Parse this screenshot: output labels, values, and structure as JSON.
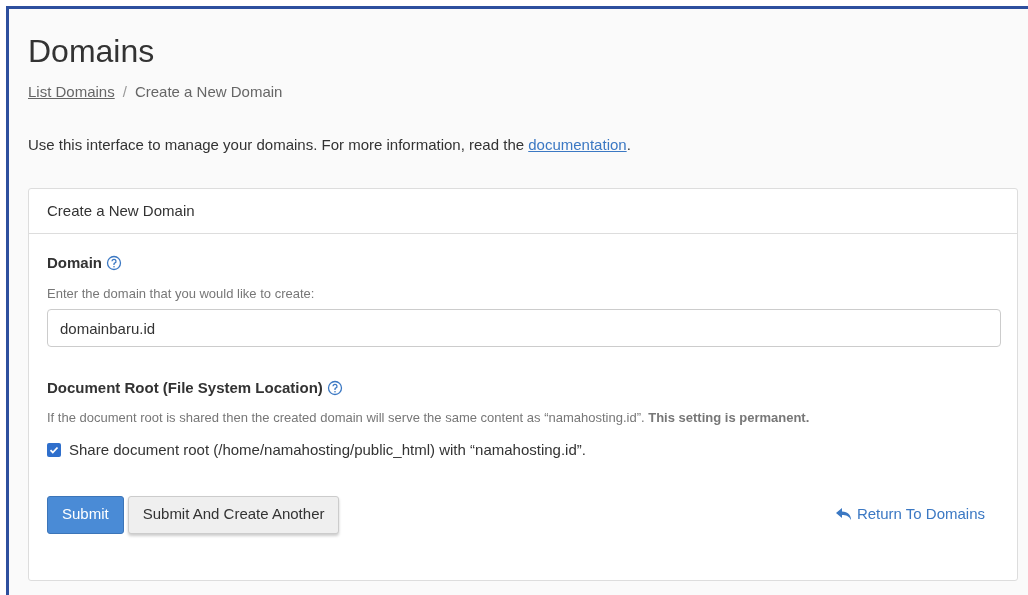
{
  "page": {
    "title": "Domains"
  },
  "breadcrumb_separator": "/",
  "breadcrumb": [
    {
      "label": "List Domains",
      "kind": "link"
    },
    {
      "label": "Create a New Domain",
      "kind": "current"
    }
  ],
  "intro": {
    "text": "Use this interface to manage your domains. For more information, read the",
    "link": "documentation",
    "end": "."
  },
  "panel": {
    "title": "Create a New Domain",
    "domain": {
      "label": "Domain",
      "hint": "Enter the domain that you would like to create:",
      "value": "domainbaru.id"
    },
    "document_root": {
      "label": "Document Root (File System Location)",
      "hint": "If the document root is shared then the created domain will serve the same content as “namahosting.id”. **This setting is permanent.**",
      "checkbox": {
        "label": "Share document root (/home/namahosting/public_html) with “namahosting.id”.",
        "checked": true
      }
    },
    "buttons": [
      {
        "label": "Submit",
        "kind": "primary"
      },
      {
        "label": "Submit And Create Another",
        "kind": "secondary"
      }
    ],
    "return_link": "Return To Domains"
  }
}
